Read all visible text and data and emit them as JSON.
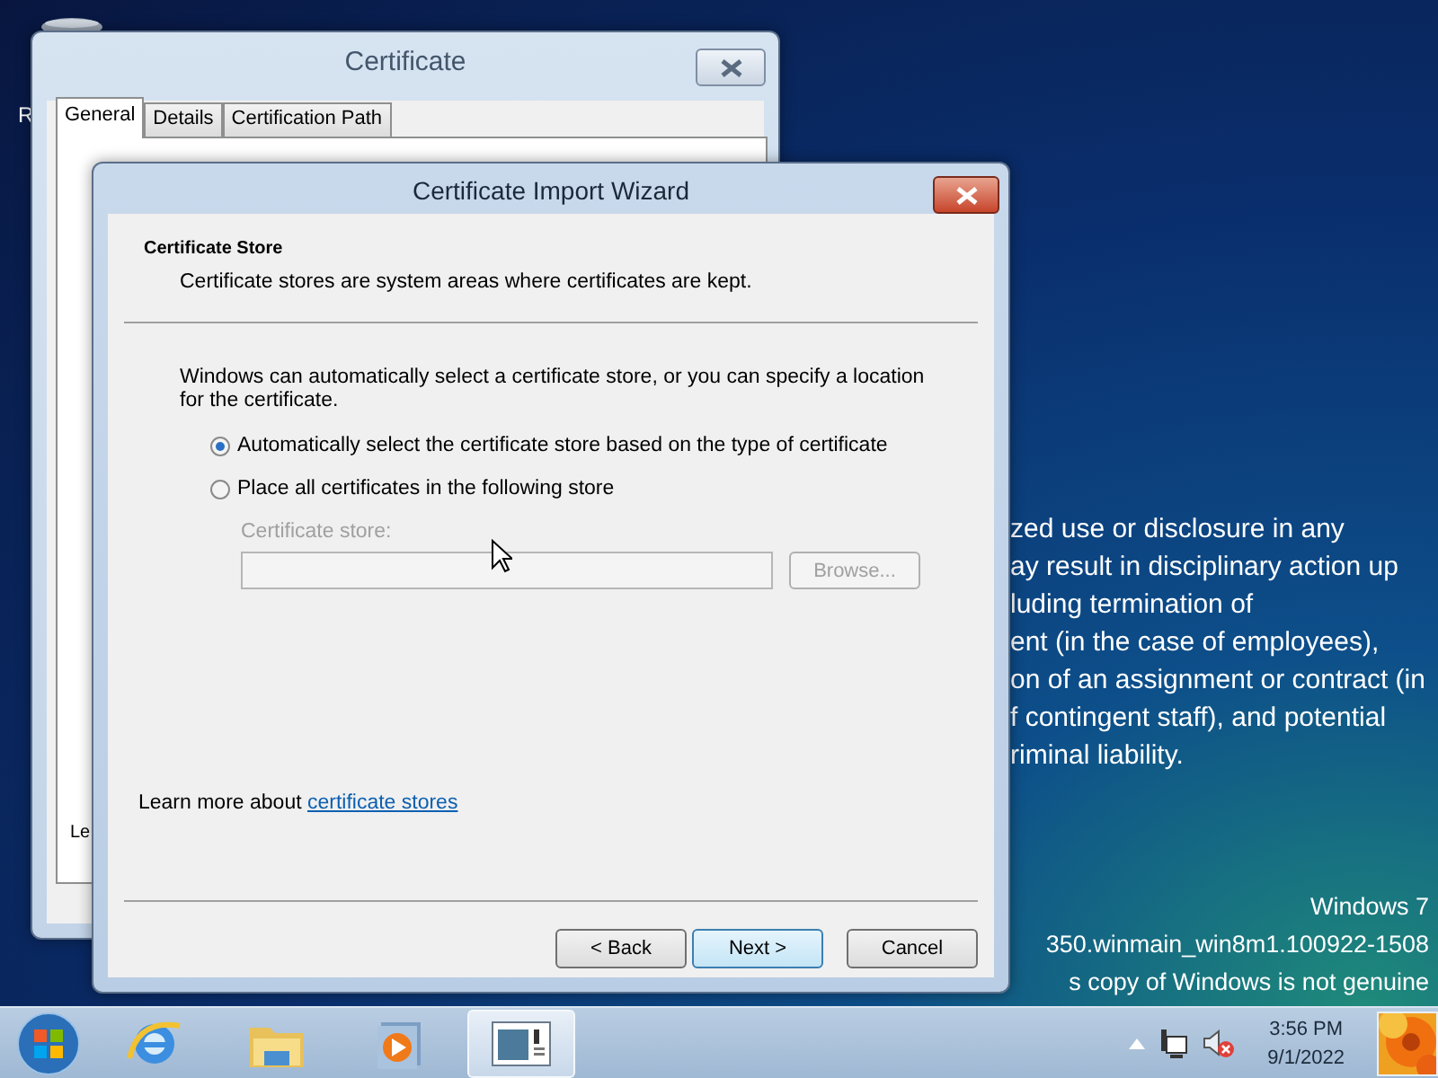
{
  "desktop": {
    "icon_label": "R",
    "notice_lines": [
      "zed use or disclosure in any",
      "ay result in disciplinary action up",
      "luding termination of",
      "ent (in the case of employees),",
      "on of an assignment or contract (in",
      "f contingent staff), and potential",
      "riminal liability."
    ],
    "build_lines": [
      "Windows 7",
      "350.winmain_win8m1.100922-1508",
      "s copy of Windows is not genuine"
    ]
  },
  "certificate_window": {
    "title": "Certificate",
    "tabs": [
      {
        "label": "General",
        "selected": true
      },
      {
        "label": "Details",
        "selected": false
      },
      {
        "label": "Certification Path",
        "selected": false
      }
    ],
    "panel_text": "Le"
  },
  "wizard": {
    "title": "Certificate Import Wizard",
    "heading": "Certificate Store",
    "subheading": "Certificate stores are system areas where certificates are kept.",
    "description": "Windows can automatically select a certificate store, or you can specify a location for the certificate.",
    "options": [
      {
        "label": "Automatically select the certificate store based on the type of certificate",
        "selected": true
      },
      {
        "label": "Place all certificates in the following store",
        "selected": false
      }
    ],
    "store": {
      "label": "Certificate store:",
      "disabled": true
    },
    "browse_button": {
      "label": "Browse...",
      "disabled": true
    },
    "learn_more": {
      "text": "Learn more about ",
      "link": "certificate stores"
    },
    "buttons": [
      {
        "label": "< Back",
        "default": false
      },
      {
        "label": "Next >",
        "default": true
      },
      {
        "label": "Cancel",
        "default": false
      }
    ]
  },
  "taskbar": {
    "items": [
      {
        "kind": "browser",
        "selected": false
      },
      {
        "kind": "folder",
        "selected": false
      },
      {
        "kind": "media",
        "selected": false
      },
      {
        "kind": "window",
        "selected": true
      }
    ],
    "time": "3:56 PM",
    "date": "9/1/2022"
  }
}
